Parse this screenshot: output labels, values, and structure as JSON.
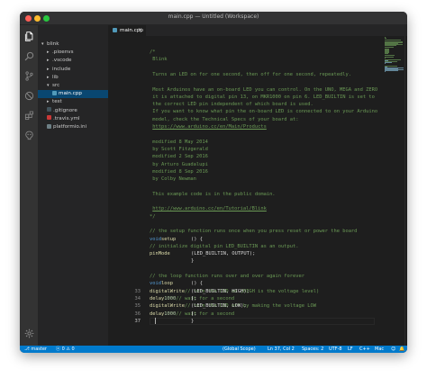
{
  "window": {
    "title": "main.cpp — Untitled (Workspace)"
  },
  "activity_bar": {
    "icons": [
      "files-icon",
      "search-icon",
      "source-control-icon",
      "debug-icon",
      "extensions-icon",
      "platformio-icon",
      "settings-gear-icon"
    ]
  },
  "sidebar": {
    "items": [
      {
        "label": "blink",
        "type": "folder",
        "expanded": true
      },
      {
        "label": ".pioenvs",
        "type": "folder",
        "expanded": false
      },
      {
        "label": ".vscode",
        "type": "folder",
        "expanded": false
      },
      {
        "label": "include",
        "type": "folder",
        "expanded": false
      },
      {
        "label": "lib",
        "type": "folder",
        "expanded": false
      },
      {
        "label": "src",
        "type": "folder",
        "expanded": true
      },
      {
        "label": "main.cpp",
        "type": "file",
        "selected": true,
        "icon_color": "#519aba"
      },
      {
        "label": "test",
        "type": "folder",
        "expanded": false
      },
      {
        "label": ".gitignore",
        "type": "file",
        "icon_color": "#41535b"
      },
      {
        "label": ".travis.yml",
        "type": "file",
        "icon_color": "#cb3837"
      },
      {
        "label": "platformio.ini",
        "type": "file",
        "icon_color": "#6d8086"
      }
    ]
  },
  "editor": {
    "tab": {
      "label": "main.cpp",
      "close": "×"
    },
    "lines": [
      [
        [
          "cmt",
          "/*"
        ]
      ],
      [
        [
          "cmt",
          " Blink"
        ]
      ],
      [],
      [
        [
          "cmt",
          " Turns an LED on for one second, then off for one second, repeatedly."
        ]
      ],
      [],
      [
        [
          "cmt",
          " Most Arduinos have an on-board LED you can control. On the UNO, MEGA and ZERO"
        ]
      ],
      [
        [
          "cmt",
          " it is attached to digital pin 13, on MKR1000 on pin 6. LED_BUILTIN is set to"
        ]
      ],
      [
        [
          "cmt",
          " the correct LED pin independent of which board is used."
        ]
      ],
      [
        [
          "cmt",
          " If you want to know what pin the on-board LED is connected to on your Arduino"
        ]
      ],
      [
        [
          "cmt",
          " model, check the Technical Specs of your board at:"
        ]
      ],
      [
        [
          "cmt",
          " "
        ],
        [
          "link",
          "https://www.arduino.cc/en/Main/Products"
        ]
      ],
      [],
      [
        [
          "cmt",
          " modified 8 May 2014"
        ]
      ],
      [
        [
          "cmt",
          " by Scott Fitzgerald"
        ]
      ],
      [
        [
          "cmt",
          " modified 2 Sep 2016"
        ]
      ],
      [
        [
          "cmt",
          " by Arturo Guadalupi"
        ]
      ],
      [
        [
          "cmt",
          " modified 8 Sep 2016"
        ]
      ],
      [
        [
          "cmt",
          " by Colby Newman"
        ]
      ],
      [],
      [
        [
          "cmt",
          " This example code is in the public domain."
        ]
      ],
      [],
      [
        [
          "cmt",
          " "
        ],
        [
          "link",
          "http://www.arduino.cc/en/Tutorial/Blink"
        ]
      ],
      [
        [
          "cmt",
          "*/"
        ]
      ],
      [],
      [
        [
          "cmt",
          "// the setup function runs once when you press reset or power the board"
        ]
      ],
      [
        [
          "kw",
          "void"
        ],
        [
          "txt",
          " "
        ],
        [
          "fn",
          "setup"
        ],
        [
          "txt",
          "() {"
        ]
      ],
      [
        [
          "txt",
          "  "
        ],
        [
          "cmt",
          "// initialize digital pin LED_BUILTIN as an output."
        ]
      ],
      [
        [
          "txt",
          "  "
        ],
        [
          "fn",
          "pinMode"
        ],
        [
          "txt",
          "(LED_BUILTIN, OUTPUT);"
        ]
      ],
      [
        [
          "txt",
          "}"
        ]
      ],
      [],
      [
        [
          "cmt",
          "// the loop function runs over and over again forever"
        ]
      ],
      [
        [
          "kw",
          "void"
        ],
        [
          "txt",
          " "
        ],
        [
          "fn",
          "loop"
        ],
        [
          "txt",
          "() {"
        ]
      ],
      [
        [
          "txt",
          "  "
        ],
        [
          "fn",
          "digitalWrite"
        ],
        [
          "txt",
          "(LED_BUILTIN, HIGH);   "
        ],
        [
          "cmt",
          "// turn the LED on (HIGH is the voltage level)"
        ]
      ],
      [
        [
          "txt",
          "  "
        ],
        [
          "fn",
          "delay"
        ],
        [
          "txt",
          "("
        ],
        [
          "num",
          "1000"
        ],
        [
          "txt",
          ");                       "
        ],
        [
          "cmt",
          "// wait for a second"
        ]
      ],
      [
        [
          "txt",
          "  "
        ],
        [
          "fn",
          "digitalWrite"
        ],
        [
          "txt",
          "(LED_BUILTIN, LOW);    "
        ],
        [
          "cmt",
          "// turn the LED off by making the voltage LOW"
        ]
      ],
      [
        [
          "txt",
          "  "
        ],
        [
          "fn",
          "delay"
        ],
        [
          "txt",
          "("
        ],
        [
          "num",
          "1000"
        ],
        [
          "txt",
          ");                       "
        ],
        [
          "cmt",
          "// wait for a second"
        ]
      ],
      [
        [
          "txt",
          "}"
        ]
      ],
      []
    ],
    "line_numbers": [
      "",
      "",
      "",
      "",
      "",
      "",
      "",
      "",
      "",
      "",
      "",
      "",
      "",
      "",
      "",
      "",
      "",
      "",
      "",
      "",
      "",
      "",
      "",
      "",
      "",
      "",
      "",
      "",
      "",
      "",
      "",
      "",
      "33",
      "34",
      "35",
      "36",
      "37"
    ],
    "current_line": 37
  },
  "statusbar": {
    "branch": "master",
    "errors": "0",
    "warnings": "0",
    "scope": "(Global Scope)",
    "position": "Ln 37, Col 2",
    "spaces": "Spaces: 2",
    "encoding": "UTF-8",
    "eol": "LF",
    "language": "C++",
    "platform": "Mac",
    "colors": {
      "background": "#007acc"
    }
  }
}
